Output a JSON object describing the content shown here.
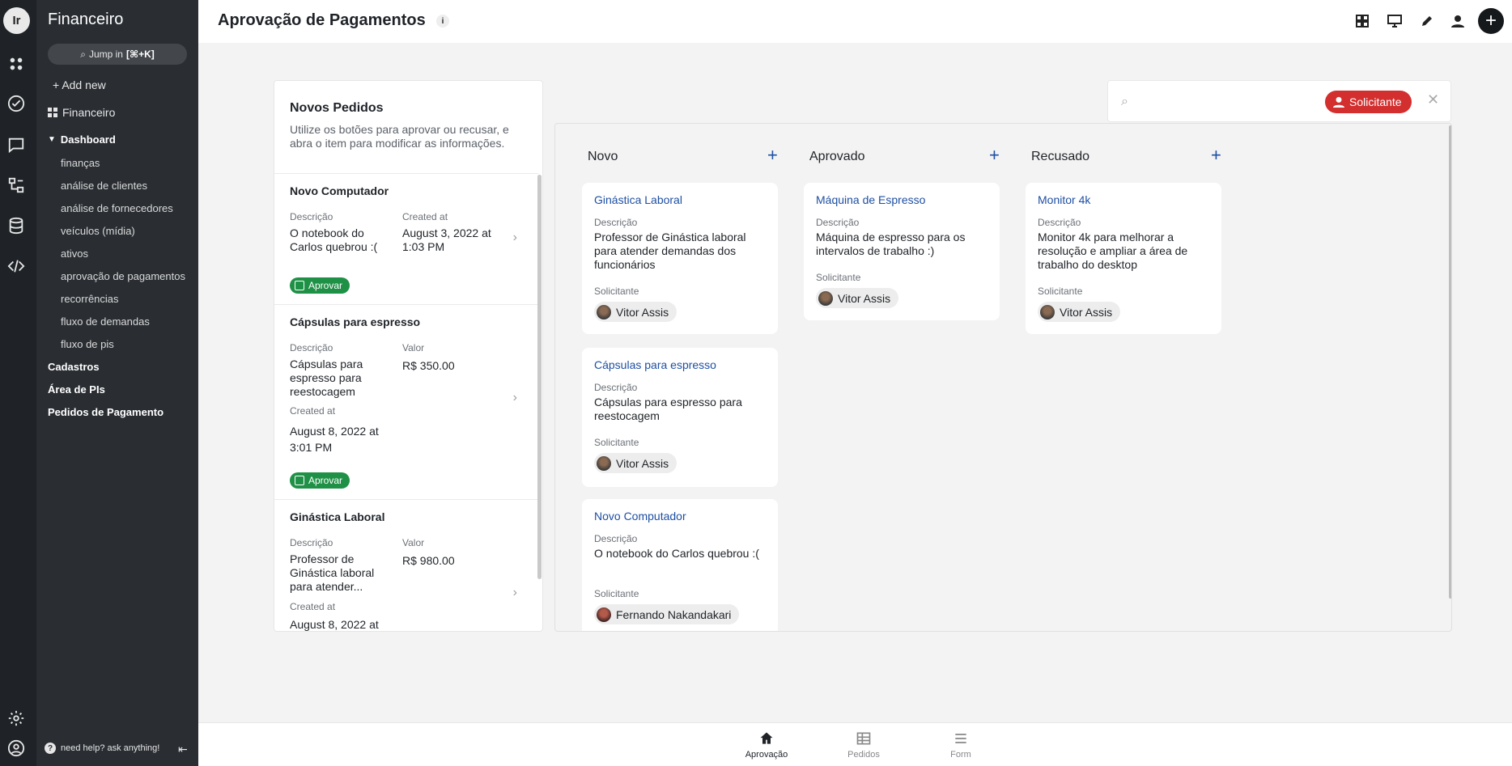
{
  "rail": {
    "logo_text": "Ir",
    "icons": [
      "apps-icon",
      "check-circle-icon",
      "chat-icon",
      "workflow-icon",
      "database-icon",
      "code-icon",
      "gear-icon",
      "user-circle-icon"
    ]
  },
  "sidebar": {
    "title": "Financeiro",
    "jump": {
      "label": "Jump in",
      "shortcut": "[⌘+K]"
    },
    "add_new": "Add new",
    "app_name": "Financeiro",
    "dashboard_label": "Dashboard",
    "dashboard_items": [
      "finanças",
      "análise de clientes",
      "análise de fornecedores",
      "veículos (mídia)",
      "ativos",
      "aprovação de pagamentos",
      "recorrências",
      "fluxo de demandas",
      "fluxo de pis"
    ],
    "sections": [
      "Cadastros",
      "Área de PIs",
      "Pedidos de Pagamento"
    ],
    "help": "need help? ask anything!"
  },
  "header": {
    "title": "Aprovação de Pagamentos",
    "info": "i"
  },
  "novos_pedidos": {
    "title": "Novos Pedidos",
    "description": "Utilize os botões para aprovar ou recusar, e abra o item para modificar as informações.",
    "approve_label": "Aprovar",
    "cards": [
      {
        "title": "Novo Computador",
        "desc_label": "Descrição",
        "desc": "O notebook do Carlos quebrou :(",
        "created_label": "Created at",
        "created": "August 3, 2022 at 1:03 PM"
      },
      {
        "title": "Cápsulas para espresso",
        "desc_label": "Descrição",
        "desc": "Cápsulas para espresso para reestocagem",
        "value_label": "Valor",
        "value": "R$ 350.00",
        "created_label": "Created at",
        "created": "August 8, 2022 at 3:01 PM"
      },
      {
        "title": "Ginástica Laboral",
        "desc_label": "Descrição",
        "desc": "Professor de Ginástica laboral para atender...",
        "value_label": "Valor",
        "value": "R$ 980.00",
        "created_label": "Created at",
        "created": "August 8, 2022 at"
      }
    ]
  },
  "search": {
    "filter_label": "Solicitante",
    "close": "✕"
  },
  "kanban": {
    "desc_label": "Descrição",
    "req_label": "Solicitante",
    "columns": [
      {
        "title": "Novo",
        "cards": [
          {
            "title": "Ginástica Laboral",
            "desc": "Professor de Ginástica laboral para atender demandas dos funcionários",
            "requester": "Vitor Assis"
          },
          {
            "title": "Cápsulas para espresso",
            "desc": "Cápsulas para espresso para reestocagem",
            "requester": "Vitor Assis"
          },
          {
            "title": "Novo Computador",
            "desc": "O notebook do Carlos quebrou :(",
            "requester": "Fernando Nakandakari"
          }
        ]
      },
      {
        "title": "Aprovado",
        "cards": [
          {
            "title": "Máquina de Espresso",
            "desc": "Máquina de espresso para os intervalos de trabalho :)",
            "requester": "Vitor Assis"
          }
        ]
      },
      {
        "title": "Recusado",
        "cards": [
          {
            "title": "Monitor 4k",
            "desc": "Monitor 4k para melhorar a resolução e ampliar a área de trabalho do desktop",
            "requester": "Vitor Assis"
          }
        ]
      }
    ]
  },
  "bottom_tabs": [
    {
      "label": "Aprovação",
      "icon": "home-icon",
      "active": true
    },
    {
      "label": "Pedidos",
      "icon": "table-icon",
      "active": false
    },
    {
      "label": "Form",
      "icon": "list-icon",
      "active": false
    }
  ]
}
